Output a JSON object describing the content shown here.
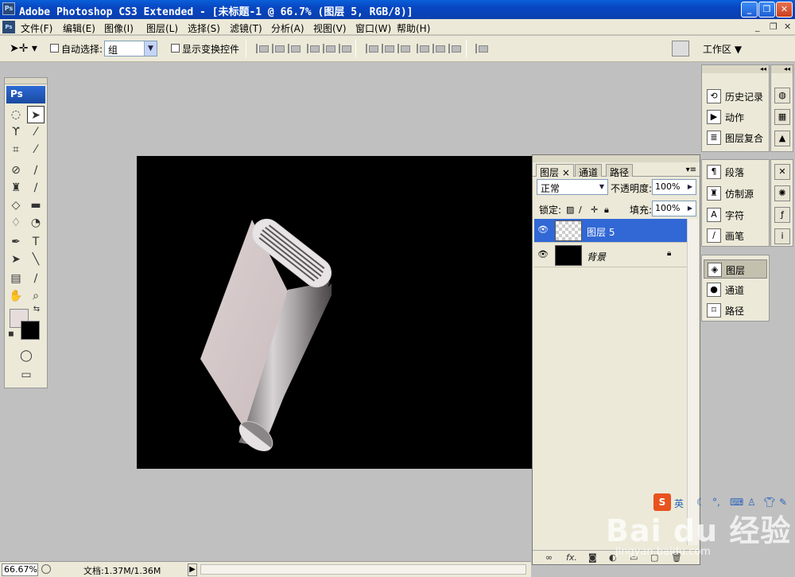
{
  "window": {
    "title": "Adobe Photoshop CS3 Extended - [未标题-1 @ 66.7% (图层 5, RGB/8)]",
    "app_badge": "Ps",
    "buttons": [
      "_",
      "❐",
      "✕"
    ]
  },
  "menubar": {
    "doc_badge": "Ps",
    "items": [
      "文件(F)",
      "编辑(E)",
      "图像(I)",
      "图层(L)",
      "选择(S)",
      "滤镜(T)",
      "分析(A)",
      "视图(V)",
      "窗口(W)",
      "帮助(H)"
    ],
    "doc_buttons": [
      "_",
      "❐",
      "✕"
    ]
  },
  "options": {
    "auto_select_label": "自动选择:",
    "auto_select_value": "组",
    "show_transform_label": "显示变换控件",
    "workspace_label": "工作区 ▼"
  },
  "toolbox": {
    "title": "Ps",
    "icons": [
      "marquee-icon",
      "move-icon",
      "lasso-icon",
      "magic-wand-icon",
      "crop-icon",
      "slice-icon",
      "spot-heal-icon",
      "brush-icon",
      "clone-stamp-icon",
      "history-brush-icon",
      "eraser-icon",
      "gradient-icon",
      "blur-icon",
      "dodge-icon",
      "pen-icon",
      "type-icon",
      "path-select-icon",
      "line-icon",
      "notes-icon",
      "eyedropper-icon",
      "hand-icon",
      "zoom-icon"
    ],
    "foreground_color": "#e6dcdc",
    "background_color": "#000000"
  },
  "layers_panel": {
    "tabs": [
      "图层 ×",
      "通道",
      "路径"
    ],
    "blend_mode": "正常",
    "opacity_label": "不透明度:",
    "opacity_value": "100%",
    "lock_label": "锁定:",
    "fill_label": "填充:",
    "fill_value": "100%",
    "layers": [
      {
        "name": "图层 5",
        "selected": true,
        "locked": false
      },
      {
        "name": "背景",
        "selected": false,
        "locked": true
      }
    ],
    "bottom_icons": [
      "link-icon",
      "fx-icon",
      "mask-icon",
      "adjustment-icon",
      "group-icon",
      "new-layer-icon",
      "trash-icon"
    ],
    "bottom_labels": [
      "∞",
      "fx."
    ]
  },
  "dock_panels": {
    "group1": [
      "历史记录",
      "动作",
      "图层复合"
    ],
    "group2": [
      "段落",
      "仿制源",
      "字符",
      "画笔"
    ],
    "group3": [
      "图层",
      "通道",
      "路径"
    ]
  },
  "status": {
    "zoom": "66.67%",
    "doc_info": "文档:1.37M/1.36M"
  },
  "watermark": {
    "brand": "Bai du 经验",
    "url": "jingyan.baidu.com"
  },
  "ime_bar": {
    "logo": "S",
    "mode": "英"
  }
}
